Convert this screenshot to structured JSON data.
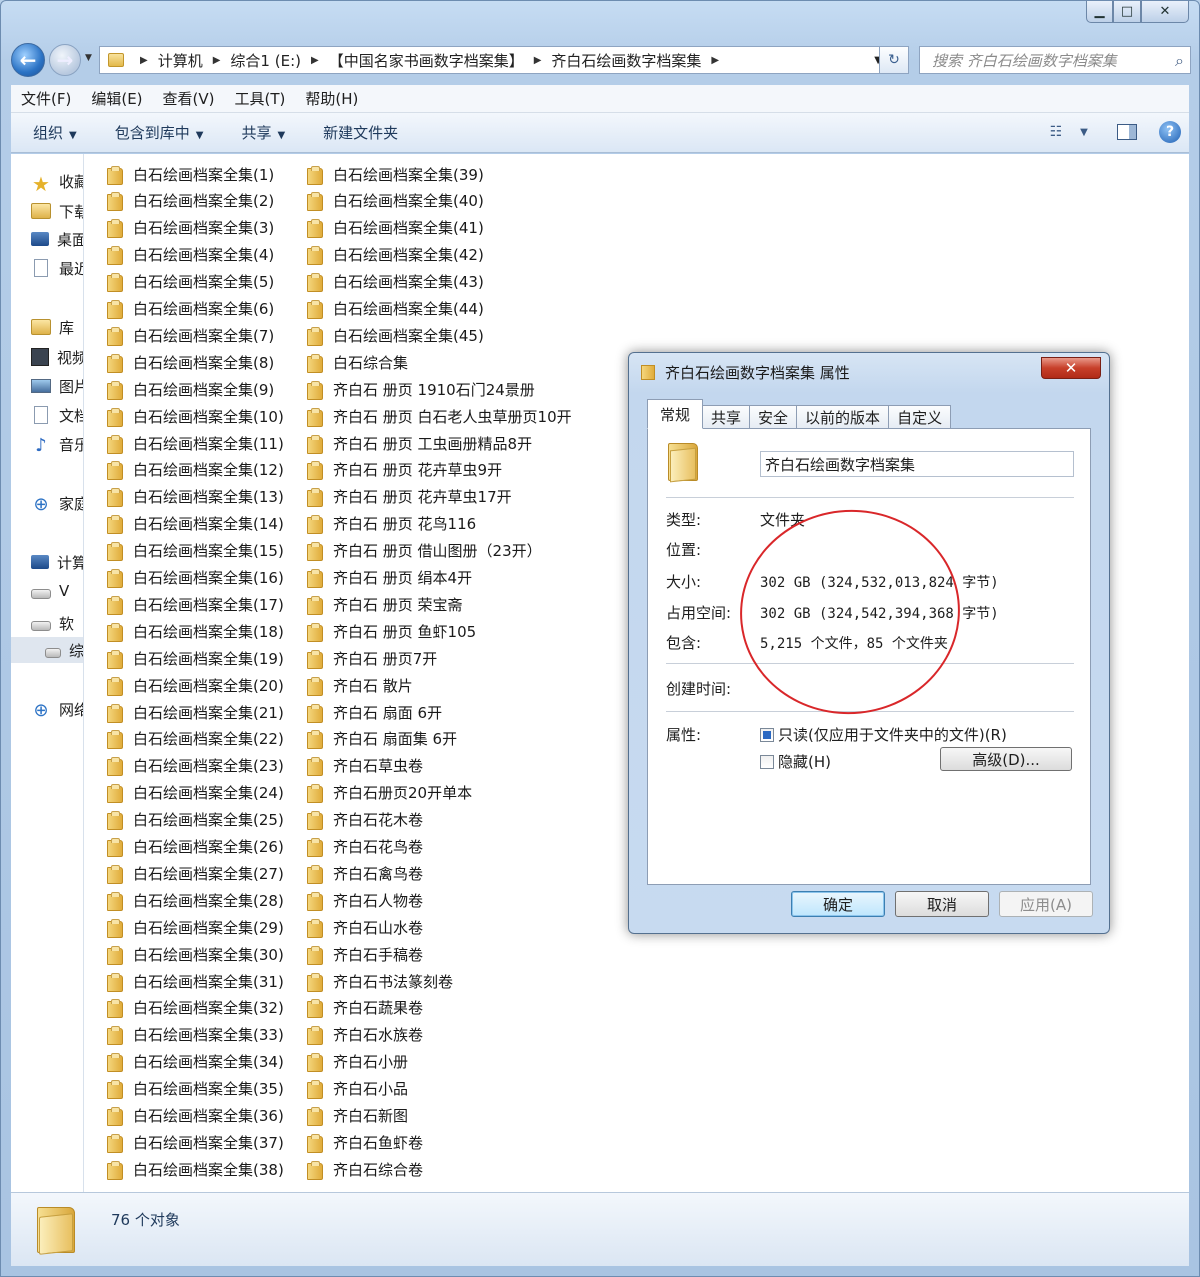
{
  "window": {
    "minimize_icon": "minimize-icon",
    "maximize_icon": "maximize-icon",
    "close_icon": "close-icon"
  },
  "address": {
    "crumbs": [
      "计算机",
      "综合1 (E:)",
      "【中国名家书画数字档案集】",
      "齐白石绘画数字档案集"
    ],
    "search_placeholder": "搜索 齐白石绘画数字档案集"
  },
  "menu": [
    "文件(F)",
    "编辑(E)",
    "查看(V)",
    "工具(T)",
    "帮助(H)"
  ],
  "commands": [
    "组织",
    "包含到库中",
    "共享",
    "新建文件夹"
  ],
  "nav": {
    "items": [
      {
        "label": "收藏",
        "icon": "star"
      },
      {
        "label": "下载",
        "icon": "lib"
      },
      {
        "label": "桌面",
        "icon": "blk"
      },
      {
        "label": "最近",
        "icon": "doc"
      },
      {
        "label": "库",
        "icon": "lib"
      },
      {
        "label": "视频",
        "icon": "vid"
      },
      {
        "label": "图片",
        "icon": "pic"
      },
      {
        "label": "文档",
        "icon": "doc"
      },
      {
        "label": "音乐",
        "icon": "note"
      },
      {
        "label": "家庭",
        "icon": "net"
      },
      {
        "label": "计算",
        "icon": "blk"
      },
      {
        "label": "V",
        "icon": "drv"
      },
      {
        "label": "软",
        "icon": "drv"
      },
      {
        "label": "综",
        "icon": "drv"
      },
      {
        "label": "网络",
        "icon": "net"
      }
    ]
  },
  "files_col1": [
    "白石绘画档案全集(1)",
    "白石绘画档案全集(2)",
    "白石绘画档案全集(3)",
    "白石绘画档案全集(4)",
    "白石绘画档案全集(5)",
    "白石绘画档案全集(6)",
    "白石绘画档案全集(7)",
    "白石绘画档案全集(8)",
    "白石绘画档案全集(9)",
    "白石绘画档案全集(10)",
    "白石绘画档案全集(11)",
    "白石绘画档案全集(12)",
    "白石绘画档案全集(13)",
    "白石绘画档案全集(14)",
    "白石绘画档案全集(15)",
    "白石绘画档案全集(16)",
    "白石绘画档案全集(17)",
    "白石绘画档案全集(18)",
    "白石绘画档案全集(19)",
    "白石绘画档案全集(20)",
    "白石绘画档案全集(21)",
    "白石绘画档案全集(22)",
    "白石绘画档案全集(23)",
    "白石绘画档案全集(24)",
    "白石绘画档案全集(25)",
    "白石绘画档案全集(26)",
    "白石绘画档案全集(27)",
    "白石绘画档案全集(28)",
    "白石绘画档案全集(29)",
    "白石绘画档案全集(30)",
    "白石绘画档案全集(31)",
    "白石绘画档案全集(32)",
    "白石绘画档案全集(33)",
    "白石绘画档案全集(34)",
    "白石绘画档案全集(35)",
    "白石绘画档案全集(36)",
    "白石绘画档案全集(37)",
    "白石绘画档案全集(38)"
  ],
  "files_col2": [
    "白石绘画档案全集(39)",
    "白石绘画档案全集(40)",
    "白石绘画档案全集(41)",
    "白石绘画档案全集(42)",
    "白石绘画档案全集(43)",
    "白石绘画档案全集(44)",
    "白石绘画档案全集(45)",
    "白石综合集",
    "齐白石 册页 1910石门24景册",
    "齐白石 册页 白石老人虫草册页10开",
    "齐白石 册页 工虫画册精品8开",
    "齐白石 册页 花卉草虫9开",
    "齐白石 册页 花卉草虫17开",
    "齐白石 册页 花鸟116",
    "齐白石 册页 借山图册（23开）",
    "齐白石 册页 绢本4开",
    "齐白石 册页 荣宝斋",
    "齐白石 册页 鱼虾105",
    "齐白石 册页7开",
    "齐白石 散片",
    "齐白石 扇面 6开",
    "齐白石 扇面集 6开",
    "齐白石草虫卷",
    "齐白石册页20开单本",
    "齐白石花木卷",
    "齐白石花鸟卷",
    "齐白石禽鸟卷",
    "齐白石人物卷",
    "齐白石山水卷",
    "齐白石手稿卷",
    "齐白石书法篆刻卷",
    "齐白石蔬果卷",
    "齐白石水族卷",
    "齐白石小册",
    "齐白石小品",
    "齐白石新图",
    "齐白石鱼虾卷",
    "齐白石综合卷"
  ],
  "status": {
    "count_text": "76 个对象"
  },
  "dialog": {
    "title": "齐白石绘画数字档案集 属性",
    "tabs": [
      "常规",
      "共享",
      "安全",
      "以前的版本",
      "自定义"
    ],
    "folder_name": "齐白石绘画数字档案集",
    "labels": {
      "type": "类型:",
      "location": "位置:",
      "size": "大小:",
      "size_on_disk": "占用空间:",
      "contains": "包含:",
      "created": "创建时间:",
      "attributes": "属性:"
    },
    "values": {
      "type": "文件夹",
      "location": "",
      "size": "302 GB (324,532,013,824 字节)",
      "size_on_disk": "302 GB (324,542,394,368 字节)",
      "contains": "5,215 个文件，85 个文件夹",
      "created": ""
    },
    "readonly_label": "只读(仅应用于文件夹中的文件)(R)",
    "hidden_label": "隐藏(H)",
    "advanced_label": "高级(D)...",
    "ok_label": "确定",
    "cancel_label": "取消",
    "apply_label": "应用(A)"
  }
}
